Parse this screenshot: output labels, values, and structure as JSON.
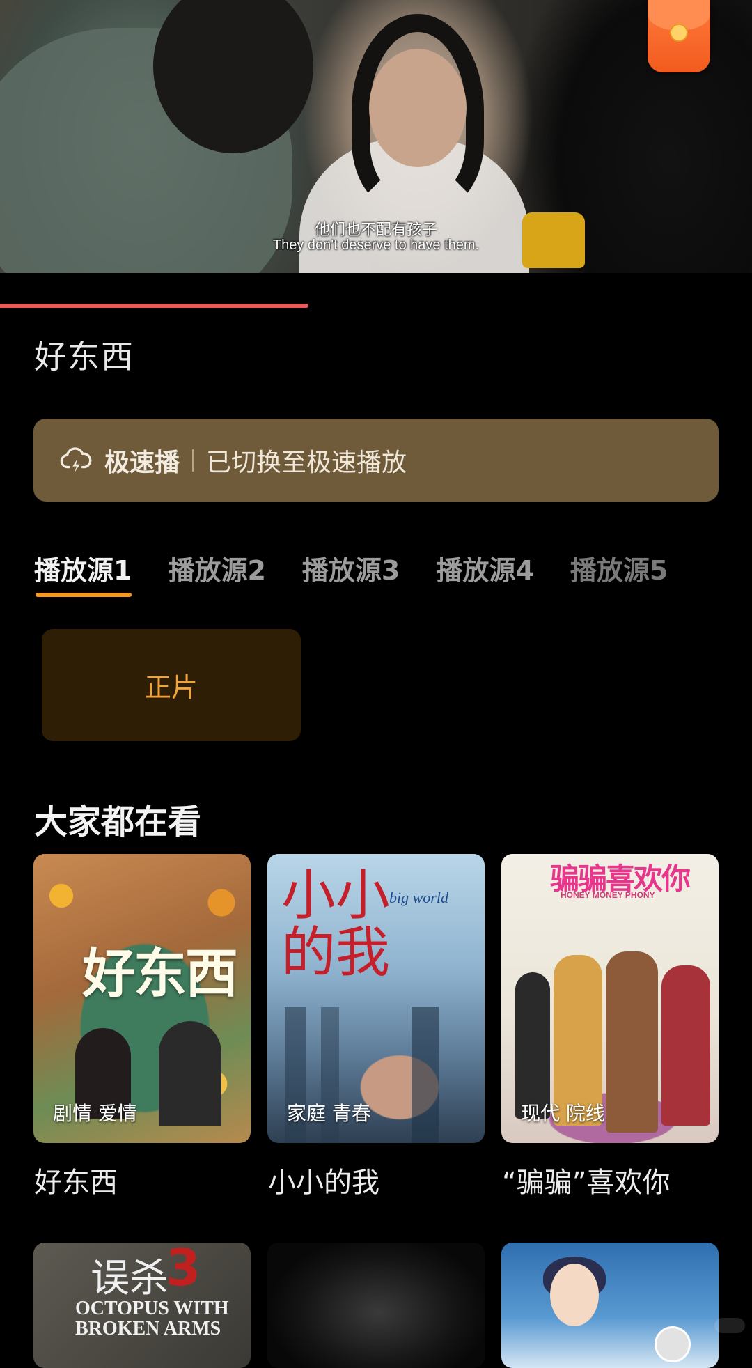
{
  "player": {
    "subtitle_cn": "他们也不配有孩子",
    "subtitle_en": "They don't deserve to have them.",
    "progress_fraction": 0.41,
    "icons": [
      "red-envelope-icon"
    ]
  },
  "movie": {
    "title": "好东西"
  },
  "notice": {
    "icon": "cloud-lightning-icon",
    "label": "极速播",
    "message": "已切换至极速播放"
  },
  "sources": {
    "tabs": [
      "播放源1",
      "播放源2",
      "播放源3",
      "播放源4",
      "播放源5"
    ],
    "active_index": 0
  },
  "episodes": [
    "正片"
  ],
  "recommend": {
    "heading": "大家都在看",
    "items": [
      {
        "name": "好东西",
        "tags": "剧情 爱情",
        "poster_text": "好东西"
      },
      {
        "name": "小小的我",
        "tags": "家庭 青春",
        "poster_text": "小小\n的我",
        "poster_sub": "big world"
      },
      {
        "name": "“骗骗”喜欢你",
        "tags": "现代 院线",
        "poster_text": "骗骗喜欢你",
        "poster_sub": "HONEY MONEY PHONY"
      }
    ],
    "row2": [
      {
        "poster_text": "误杀",
        "poster_number": "3",
        "poster_sub": "OCTOPUS WITH\nBROKEN ARMS"
      },
      {},
      {}
    ]
  },
  "colors": {
    "accent": "#f39a1e",
    "progress": "#e85a5a",
    "notice_bg": "#6f5a3a",
    "episode_bg": "#2e1e05",
    "episode_text": "#f0a33a"
  }
}
